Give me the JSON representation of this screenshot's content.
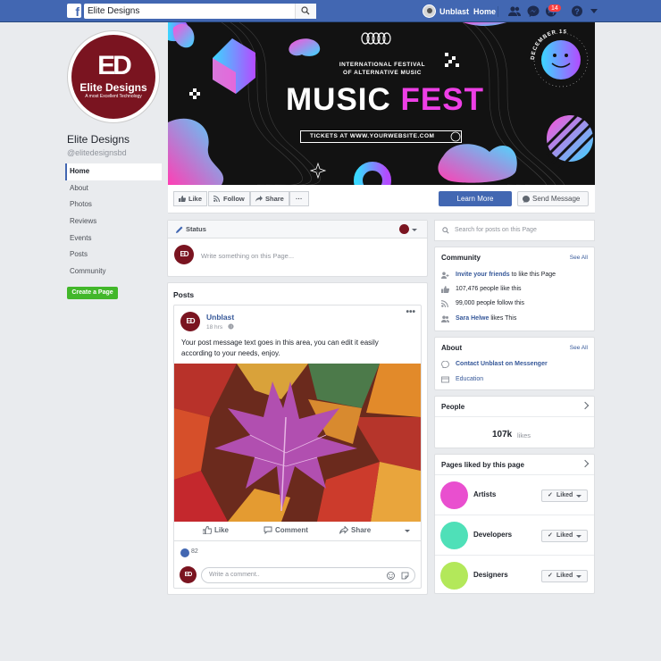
{
  "topbar": {
    "logo": "f",
    "search_value": "Elite Designs",
    "user_name": "Unblast",
    "home_label": "Home",
    "notification_count": "14"
  },
  "profile": {
    "logo_mark": "ED",
    "logo_name": "Elite Designs",
    "logo_tagline": "A most Excellent Technology",
    "page_name": "Elite Designs",
    "handle": "@elitedesignsbd"
  },
  "left_nav": {
    "items": [
      {
        "label": "Home"
      },
      {
        "label": "About"
      },
      {
        "label": "Photos"
      },
      {
        "label": "Reviews"
      },
      {
        "label": "Events"
      },
      {
        "label": "Posts"
      },
      {
        "label": "Community"
      }
    ],
    "create_page": "Create a Page"
  },
  "cover": {
    "subtitle_line1": "INTERNATIONAL FESTIVAL",
    "subtitle_line2": "OF ALTERNATIVE MUSIC",
    "title_part1": "MUSIC",
    "title_part2": "FEST",
    "tickets": "TICKETS AT WWW.YOURWEBSITE.COM",
    "date_text": "DECEMBER 15",
    "accent": "#ee3fe6"
  },
  "actions": {
    "like": "Like",
    "follow": "Follow",
    "share": "Share",
    "more": "···",
    "learn_more": "Learn More",
    "send_message": "Send Message"
  },
  "status": {
    "label": "Status",
    "placeholder": "Write something on this Page..."
  },
  "posts": {
    "section_title": "Posts",
    "author": "Unblast",
    "time": "18 hrs",
    "text": "Your post message text goes in this area, you can edit it easily according to your needs, enjoy.",
    "actions": {
      "like": "Like",
      "comment": "Comment",
      "share": "Share"
    },
    "reactions_count": "82",
    "comment_placeholder": "Write a comment.."
  },
  "sidebar": {
    "search_placeholder": "Search for posts on this Page",
    "community": {
      "title": "Community",
      "see_all": "See All",
      "invite_link": "Invite your friends",
      "invite_rest": "to like this Page",
      "likes_text": "107,476 people like this",
      "follows_text": "99,000 people follow this",
      "friend_name": "Sara Helwe",
      "friend_rest": "likes This"
    },
    "about": {
      "title": "About",
      "see_all": "See All",
      "messenger": "Contact Unblast on Messenger",
      "education": "Education"
    },
    "people": {
      "title": "People",
      "count": "107k",
      "count_label": "likes"
    },
    "pages_liked": {
      "title": "Pages liked by this page",
      "items": [
        {
          "name": "Artists",
          "color": "#e94fcf",
          "button": "Liked"
        },
        {
          "name": "Developers",
          "color": "#4fe0b8",
          "button": "Liked"
        },
        {
          "name": "Designers",
          "color": "#b3e85a",
          "button": "Liked"
        }
      ]
    }
  },
  "colors": {
    "brand_blue": "#4267b2",
    "background": "#e9ebee",
    "logo_red": "#7a1420",
    "create_green": "#42b72a"
  }
}
